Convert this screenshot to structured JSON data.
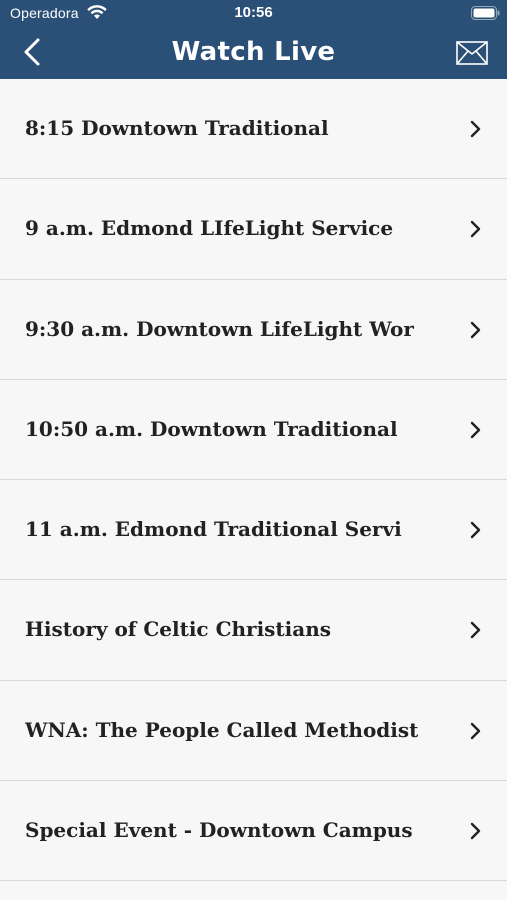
{
  "status_bar": {
    "carrier": "Operadora",
    "time": "10:56",
    "wifi_icon": "wifi-icon",
    "battery_icon": "battery-icon"
  },
  "nav": {
    "title": "Watch Live",
    "back_icon": "chevron-left-icon",
    "mail_icon": "mail-icon",
    "color": "#2b5077"
  },
  "list": {
    "items": [
      {
        "label": "8:15 Downtown Traditional"
      },
      {
        "label": "9 a.m. Edmond LIfeLight Service"
      },
      {
        "label": "9:30 a.m. Downtown LifeLight Wor"
      },
      {
        "label": "10:50 a.m. Downtown Traditional"
      },
      {
        "label": "11 a.m. Edmond Traditional Servi"
      },
      {
        "label": "History of Celtic Christians"
      },
      {
        "label": "WNA: The People Called Methodist"
      },
      {
        "label": "Special Event - Downtown Campus"
      }
    ],
    "chevron_icon": "chevron-right-icon"
  }
}
